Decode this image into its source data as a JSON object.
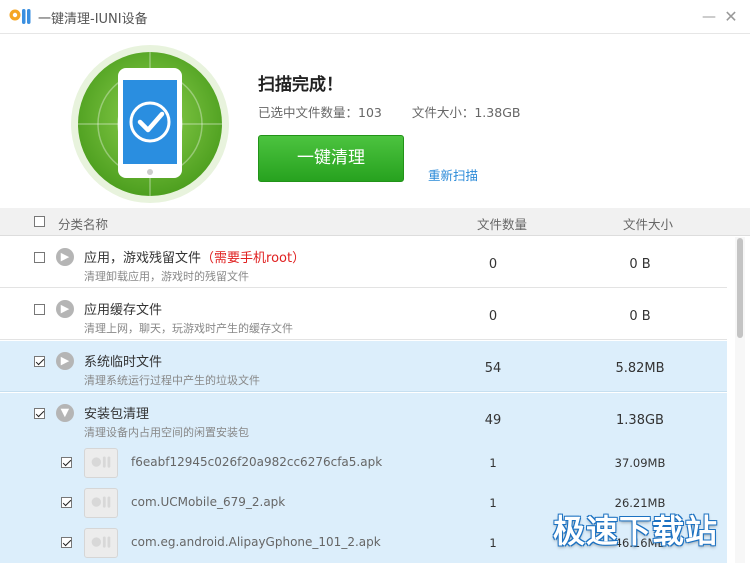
{
  "window": {
    "title": "一键清理-IUNI设备",
    "minimize_symbol": "—",
    "close_symbol": "✕"
  },
  "summary": {
    "title": "扫描完成！",
    "selected_files": "已选中文件数量：103",
    "file_size": "文件大小：1.38GB",
    "clean_button": "一键清理",
    "rescan_link": "重新扫描"
  },
  "table": {
    "columns": [
      "分类名称",
      "文件数量",
      "文件大小"
    ],
    "categories": [
      {
        "name": "应用，游戏残留文件",
        "warning": "（需要手机root）",
        "desc": "清理卸载应用，游戏时的残留文件",
        "count": "0",
        "size": "0 B",
        "checked": false,
        "expanded": false
      },
      {
        "name": "应用缓存文件",
        "warning": "",
        "desc": "清理上网，聊天，玩游戏时产生的缓存文件",
        "count": "0",
        "size": "0 B",
        "checked": false,
        "expanded": false
      },
      {
        "name": "系统临时文件",
        "warning": "",
        "desc": "清理系统运行过程中产生的垃圾文件",
        "count": "54",
        "size": "5.82MB",
        "checked": true,
        "expanded": false
      },
      {
        "name": "安装包清理",
        "warning": "",
        "desc": "清理设备内占用空间的闲置安装包",
        "count": "49",
        "size": "1.38GB",
        "checked": true,
        "expanded": true
      }
    ],
    "apk_files": [
      {
        "name": "f6eabf12945c026f20a982cc6276cfa5.apk",
        "count": "1",
        "size": "37.09MB",
        "checked": true
      },
      {
        "name": "com.UCMobile_679_2.apk",
        "count": "1",
        "size": "26.21MB",
        "checked": true
      },
      {
        "name": "com.eg.android.AlipayGphone_101_2.apk",
        "count": "1",
        "size": "46.16MB",
        "checked": true
      }
    ]
  },
  "watermark": "极速下载站",
  "colors": {
    "accent_green": "#2eaa25",
    "link_blue": "#2a8ad8",
    "selected_row": "#dceefb",
    "warning_red": "#e02020"
  },
  "icons": {
    "app_logo": "iuni-logo-icon",
    "phone": "phone-check-icon",
    "expand": "chevron-right-icon",
    "collapse": "chevron-down-icon",
    "apk": "apk-file-icon"
  }
}
